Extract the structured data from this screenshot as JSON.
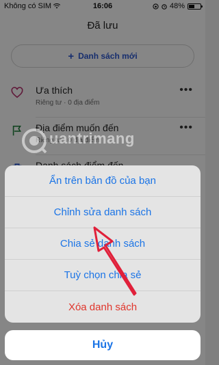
{
  "status_bar": {
    "carrier": "Không có SIM",
    "time": "16:06",
    "battery_text": "48%",
    "battery_level": 0.48
  },
  "header": {
    "title": "Đã lưu"
  },
  "new_list_button": {
    "label": "Danh sách mới"
  },
  "lists": [
    {
      "name": "Ưa thích",
      "sub": "Riêng tư · 0 địa điểm",
      "icon": "heart-icon"
    },
    {
      "name": "Địa điểm muốn đến",
      "sub": "Riêng tư · 0 địa điểm",
      "icon": "flag-icon"
    },
    {
      "name": "Danh sách điểm đến",
      "sub": "",
      "icon": "suitcase-icon"
    }
  ],
  "action_sheet": {
    "actions": [
      {
        "label": "Ẩn trên bản đồ của bạn"
      },
      {
        "label": "Chỉnh sửa danh sách"
      },
      {
        "label": "Chia sẻ danh sách"
      },
      {
        "label": "Tuỳ chọn chia sẻ"
      },
      {
        "label": "Xóa danh sách",
        "destructive": true
      }
    ],
    "cancel_label": "Hủy"
  },
  "watermark": {
    "text": "uantrimang"
  },
  "colors": {
    "accent": "#1b74e6",
    "destructive": "#e0352b",
    "heart": "#b0306a",
    "flag": "#1f7a3a",
    "suitcase": "#2a55c8",
    "arrow": "#e0203a"
  }
}
